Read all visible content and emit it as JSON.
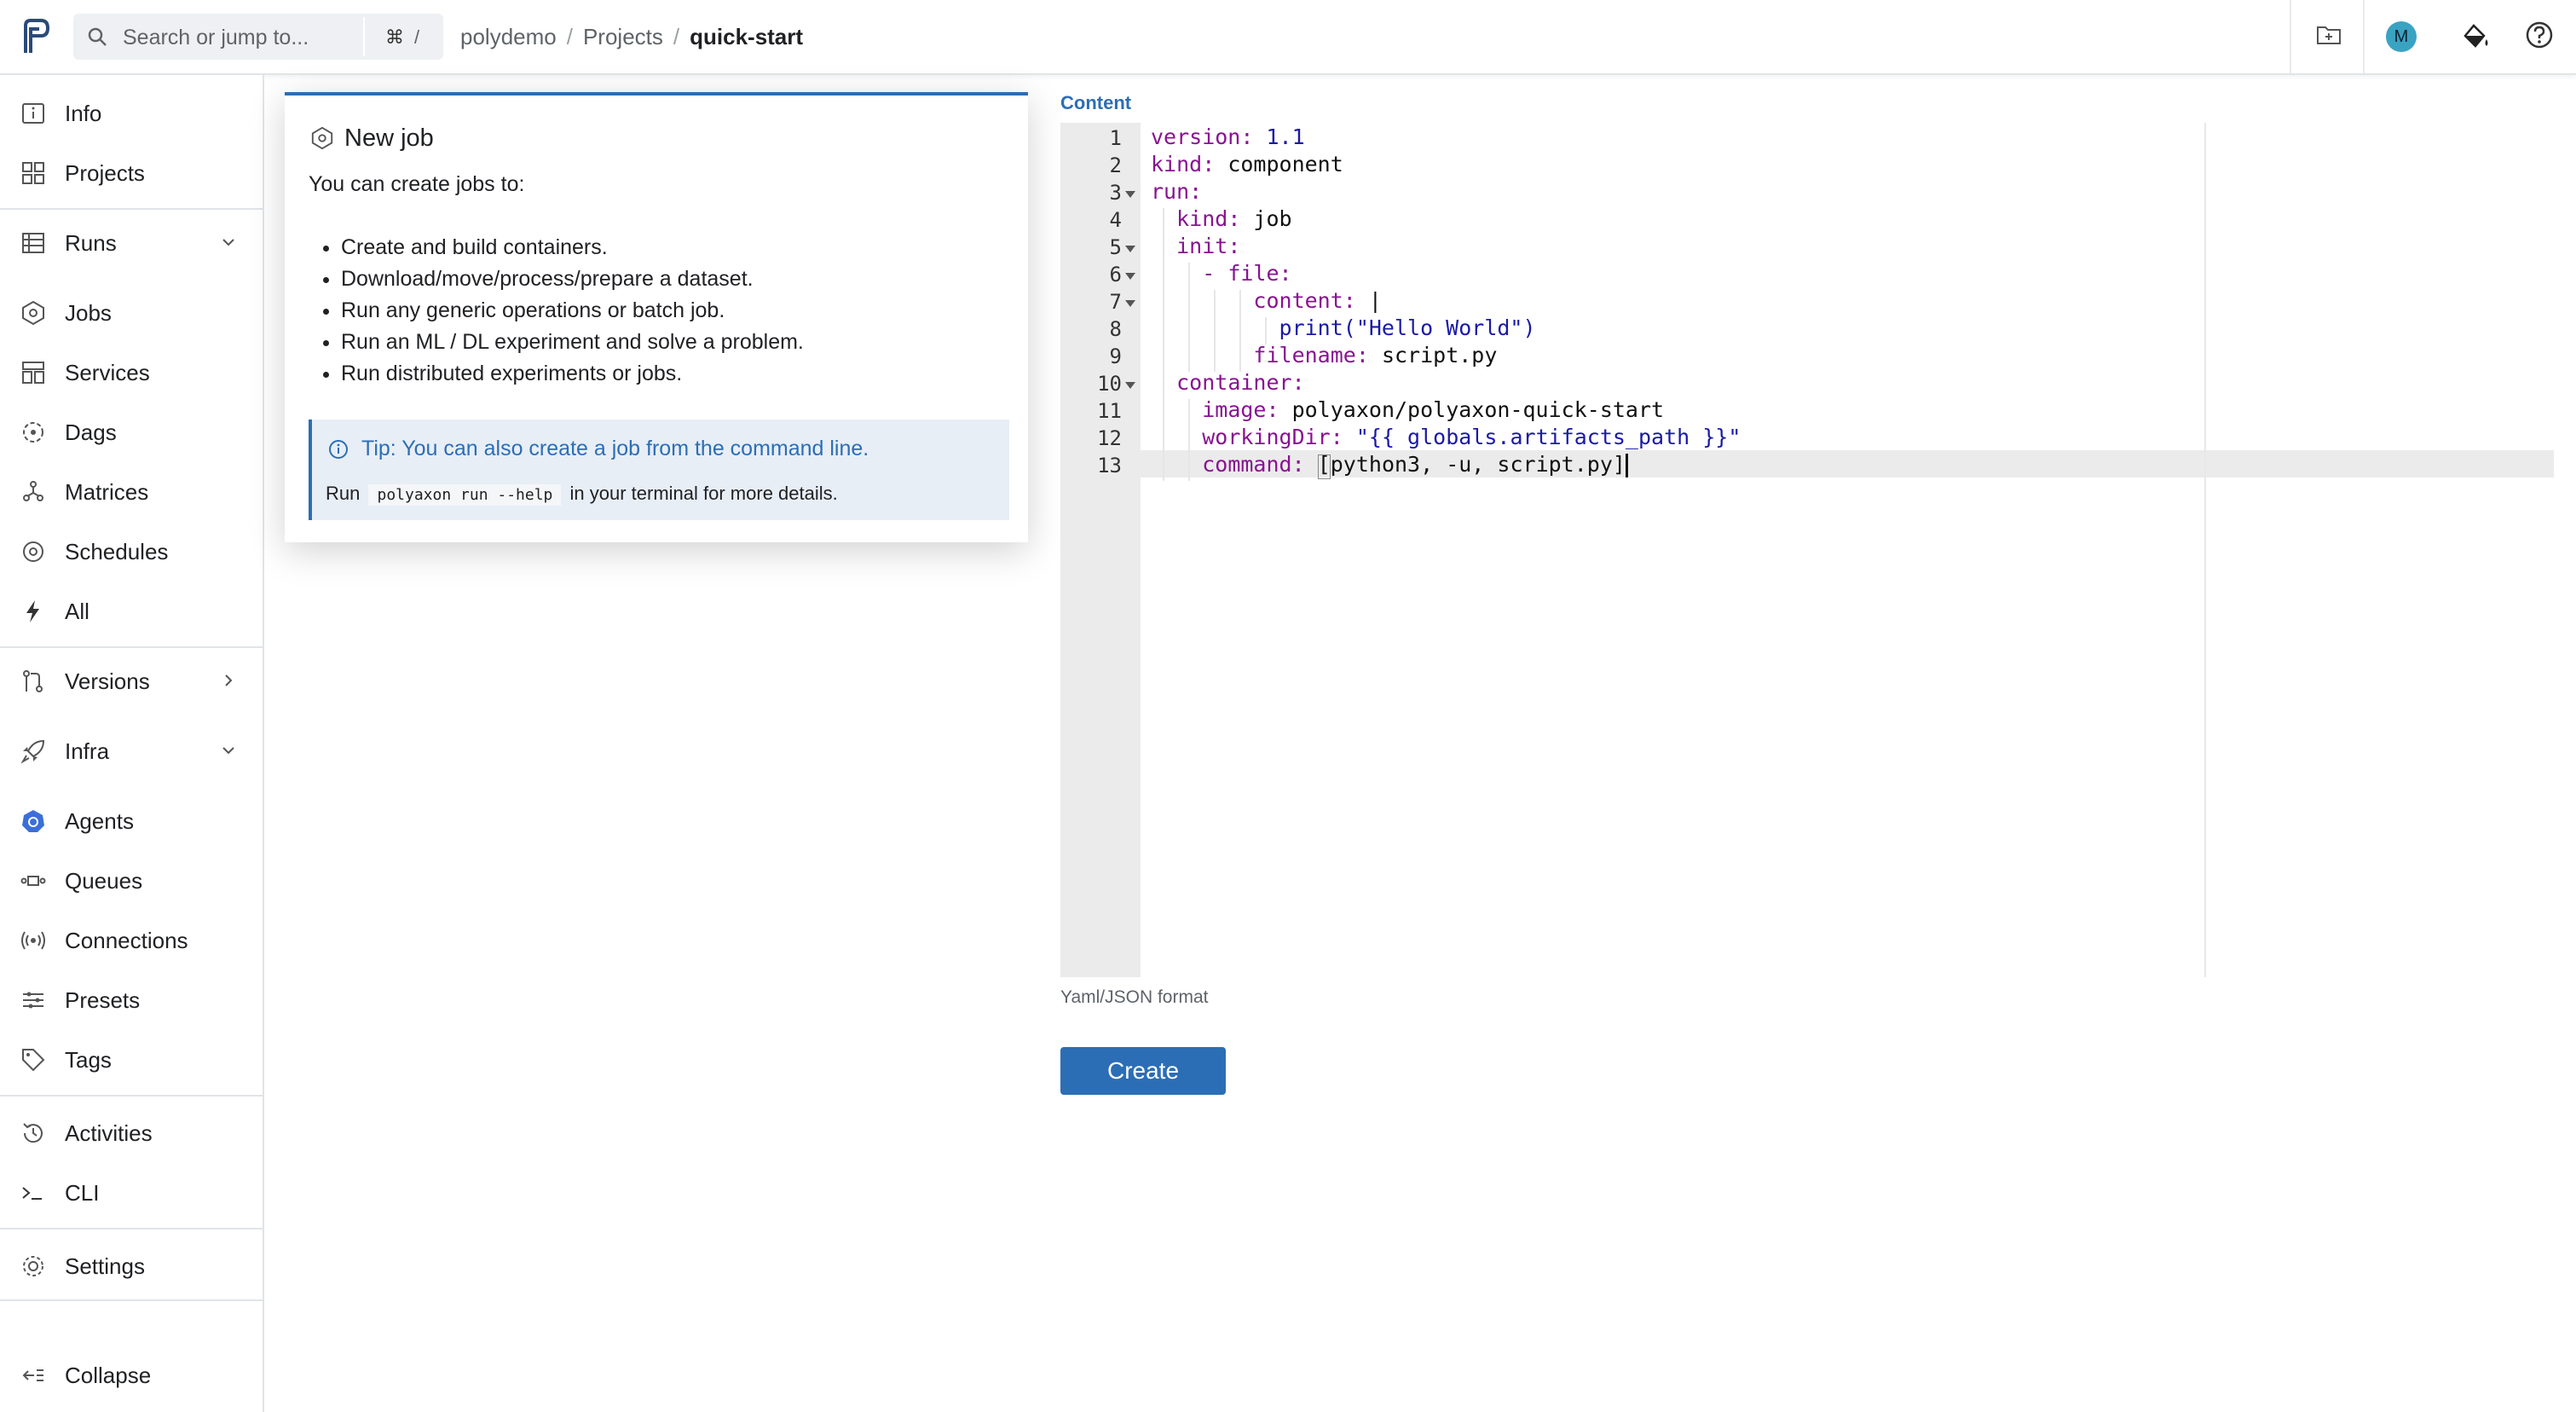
{
  "topbar": {
    "search_placeholder": "Search or jump to...",
    "shortcut_cmd": "⌘",
    "shortcut_key": "/",
    "breadcrumb": [
      "polydemo",
      "Projects",
      "quick-start"
    ],
    "avatar_initial": "M"
  },
  "sidebar": {
    "items": [
      {
        "label": "Info",
        "icon": "info-icon"
      },
      {
        "label": "Projects",
        "icon": "projects-icon"
      },
      {
        "label": "Runs",
        "icon": "runs-icon",
        "chevron": "down"
      },
      {
        "label": "Jobs",
        "icon": "jobs-icon"
      },
      {
        "label": "Services",
        "icon": "services-icon"
      },
      {
        "label": "Dags",
        "icon": "dags-icon"
      },
      {
        "label": "Matrices",
        "icon": "matrices-icon"
      },
      {
        "label": "Schedules",
        "icon": "schedules-icon"
      },
      {
        "label": "All",
        "icon": "bolt-icon"
      },
      {
        "label": "Versions",
        "icon": "versions-icon",
        "chevron": "right"
      },
      {
        "label": "Infra",
        "icon": "rocket-icon",
        "chevron": "down"
      },
      {
        "label": "Agents",
        "icon": "kubernetes-icon"
      },
      {
        "label": "Queues",
        "icon": "queues-icon"
      },
      {
        "label": "Connections",
        "icon": "connections-icon"
      },
      {
        "label": "Presets",
        "icon": "presets-icon"
      },
      {
        "label": "Tags",
        "icon": "tag-icon"
      },
      {
        "label": "Activities",
        "icon": "history-icon"
      },
      {
        "label": "CLI",
        "icon": "terminal-icon"
      },
      {
        "label": "Settings",
        "icon": "gear-icon"
      },
      {
        "label": "Collapse",
        "icon": "collapse-icon"
      }
    ]
  },
  "popover": {
    "title": "New job",
    "intro": "You can create jobs to:",
    "bullets": [
      "Create and build containers.",
      "Download/move/process/prepare a dataset.",
      "Run any generic operations or batch job.",
      "Run an ML / DL experiment and solve a problem.",
      "Run distributed experiments or jobs."
    ],
    "tip": "Tip: You can also create a job from the command line.",
    "run_prefix": "Run",
    "run_command": "polyaxon run --help",
    "run_suffix": "in your terminal for more details."
  },
  "editor": {
    "label": "Content",
    "lines": [
      "version: 1.1",
      "kind: component",
      "run:",
      "  kind: job",
      "  init:",
      "    - file:",
      "        content: |",
      "          print(\"Hello World\")",
      "        filename: script.py",
      "  container:",
      "    image: polyaxon/polyaxon-quick-start",
      "    workingDir: \"{{ globals.artifacts_path }}\"",
      "    command: [python3, -u, script.py]"
    ],
    "fold_lines": [
      3,
      5,
      6,
      7,
      10
    ],
    "active_line": 13,
    "format_hint": "Yaml/JSON format",
    "create_label": "Create"
  },
  "colors": {
    "accent": "#2c6eb5",
    "key": "#881391",
    "value": "#1a1aa6",
    "avatar": "#3aa3c2"
  }
}
